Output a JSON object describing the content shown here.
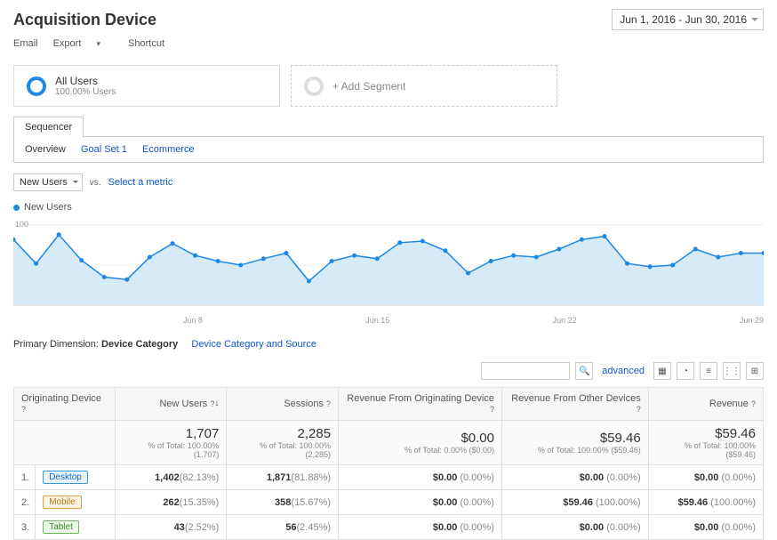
{
  "page_title": "Acquisition Device",
  "date_range": "Jun 1, 2016 - Jun 30, 2016",
  "toolbar": {
    "email": "Email",
    "export": "Export",
    "shortcut": "Shortcut"
  },
  "segments": {
    "all_users_title": "All Users",
    "all_users_sub": "100.00% Users",
    "add_segment": "+ Add Segment"
  },
  "tab": "Sequencer",
  "subnav": {
    "overview": "Overview",
    "goal": "Goal Set 1",
    "ecom": "Ecommerce"
  },
  "metric_select": "New Users",
  "vs": "vs.",
  "select_metric": "Select a metric",
  "legend": "New Users",
  "primary_dim_label": "Primary Dimension:",
  "primary_dim_value": "Device Category",
  "primary_dim_alt": "Device Category and Source",
  "advanced": "advanced",
  "table": {
    "headers": {
      "origin": "Originating Device",
      "new_users": "New Users",
      "sessions": "Sessions",
      "rev_origin": "Revenue From Originating Device",
      "rev_other": "Revenue From Other Devices",
      "revenue": "Revenue"
    },
    "totals": {
      "new_users": "1,707",
      "new_users_sub": "% of Total: 100.00% (1,707)",
      "sessions": "2,285",
      "sessions_sub": "% of Total: 100.00% (2,285)",
      "rev_origin": "$0.00",
      "rev_origin_sub": "% of Total: 0.00% ($0.00)",
      "rev_other": "$59.46",
      "rev_other_sub": "% of Total: 100.00% ($59.46)",
      "revenue": "$59.46",
      "revenue_sub": "% of Total: 100.00% ($59.46)"
    },
    "rows": [
      {
        "n": "1.",
        "label": "Desktop",
        "cls": "desktop",
        "nu": "1,402",
        "nup": "(82.13%)",
        "s": "1,871",
        "sp": "(81.88%)",
        "ro": "$0.00",
        "rop": "(0.00%)",
        "rt": "$0.00",
        "rtp": "(0.00%)",
        "r": "$0.00",
        "rp": "(0.00%)"
      },
      {
        "n": "2.",
        "label": "Mobile",
        "cls": "mobile",
        "nu": "262",
        "nup": "(15.35%)",
        "s": "358",
        "sp": "(15.67%)",
        "ro": "$0.00",
        "rop": "(0.00%)",
        "rt": "$59.46",
        "rtp": "(100.00%)",
        "r": "$59.46",
        "rp": "(100.00%)"
      },
      {
        "n": "3.",
        "label": "Tablet",
        "cls": "tablet",
        "nu": "43",
        "nup": "(2.52%)",
        "s": "56",
        "sp": "(2.45%)",
        "ro": "$0.00",
        "rop": "(0.00%)",
        "rt": "$0.00",
        "rtp": "(0.00%)",
        "r": "$0.00",
        "rp": "(0.00%)"
      }
    ]
  },
  "chart_data": {
    "type": "line",
    "ylabel": "New Users",
    "ylim": [
      0,
      100
    ],
    "yticks": [
      50,
      100
    ],
    "x_ticks": [
      "...",
      "Jun 8",
      "Jun 15",
      "Jun 22",
      "Jun 29"
    ],
    "x": [
      1,
      2,
      3,
      4,
      5,
      6,
      7,
      8,
      9,
      10,
      11,
      12,
      13,
      14,
      15,
      16,
      17,
      18,
      19,
      20,
      21,
      22,
      23,
      24,
      25,
      26,
      27,
      28,
      29,
      30
    ],
    "values": [
      82,
      52,
      88,
      56,
      35,
      32,
      60,
      77,
      62,
      55,
      50,
      58,
      65,
      30,
      55,
      62,
      58,
      78,
      80,
      68,
      40,
      55,
      62,
      60,
      70,
      82,
      86,
      52,
      48,
      50,
      70,
      60,
      65,
      65
    ]
  }
}
